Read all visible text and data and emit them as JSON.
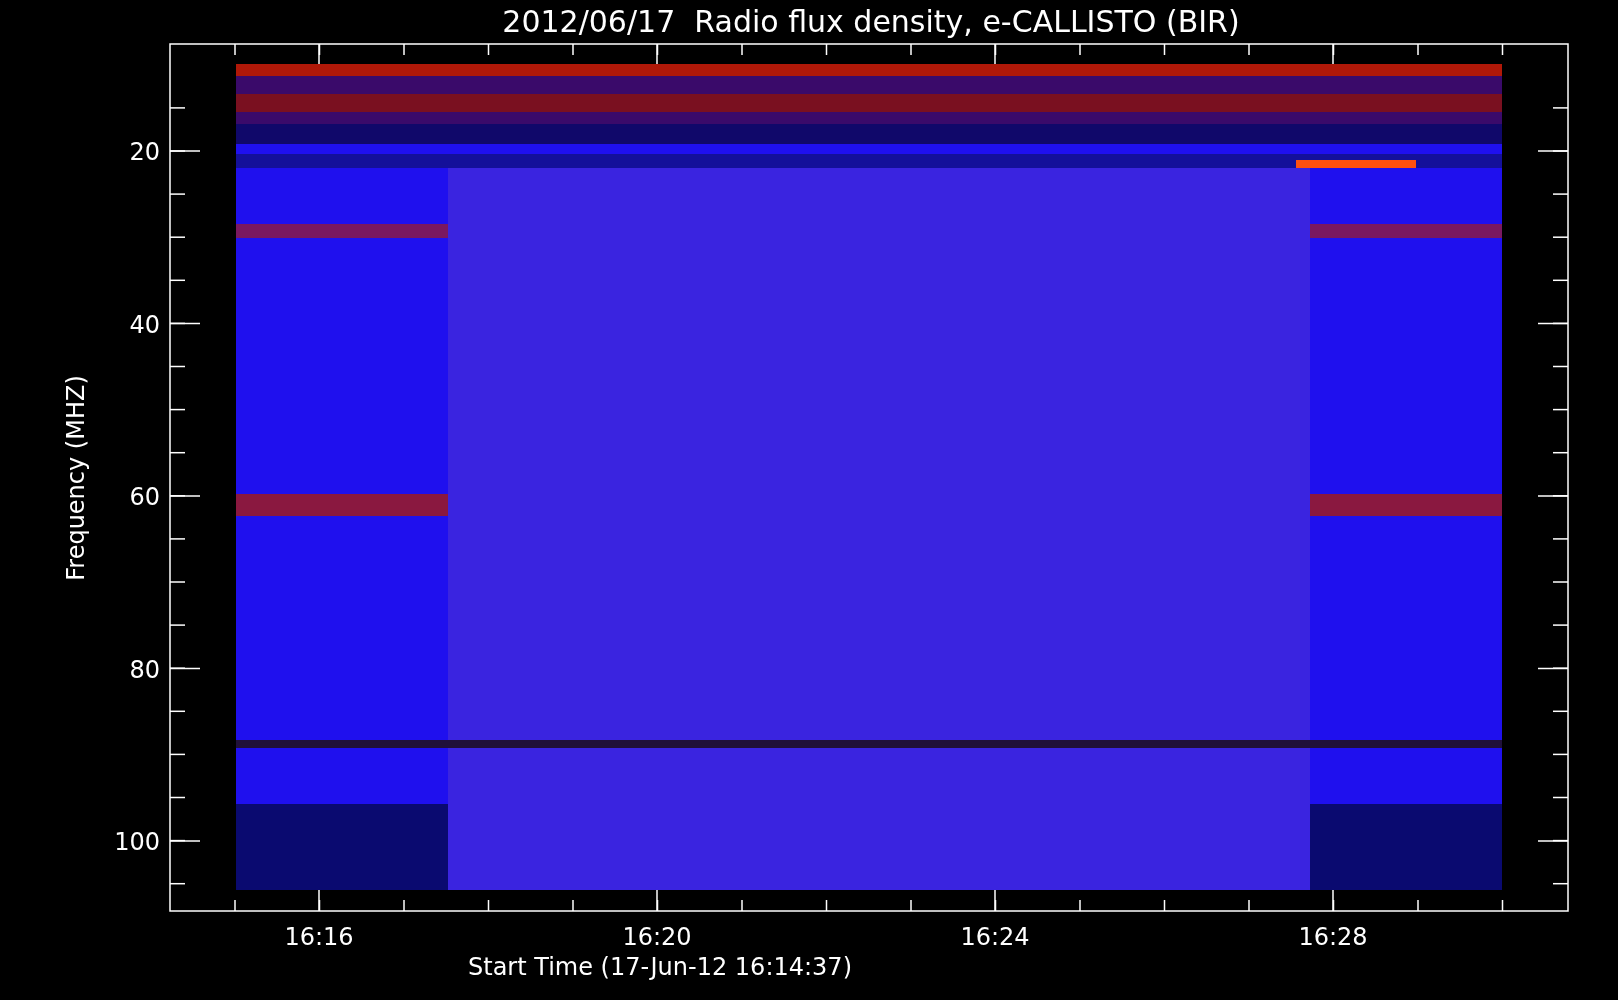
{
  "title": "2012/06/17  Radio flux density, e-CALLISTO (BIR)",
  "y_axis": {
    "label": "Frequency (MHZ)",
    "ticks": [
      "20",
      "40",
      "60",
      "80",
      "100"
    ]
  },
  "x_axis": {
    "label": "Start Time (17-Jun-12 16:14:37)",
    "ticks": [
      "16:16",
      "16:20",
      "16:24",
      "16:28"
    ]
  }
}
